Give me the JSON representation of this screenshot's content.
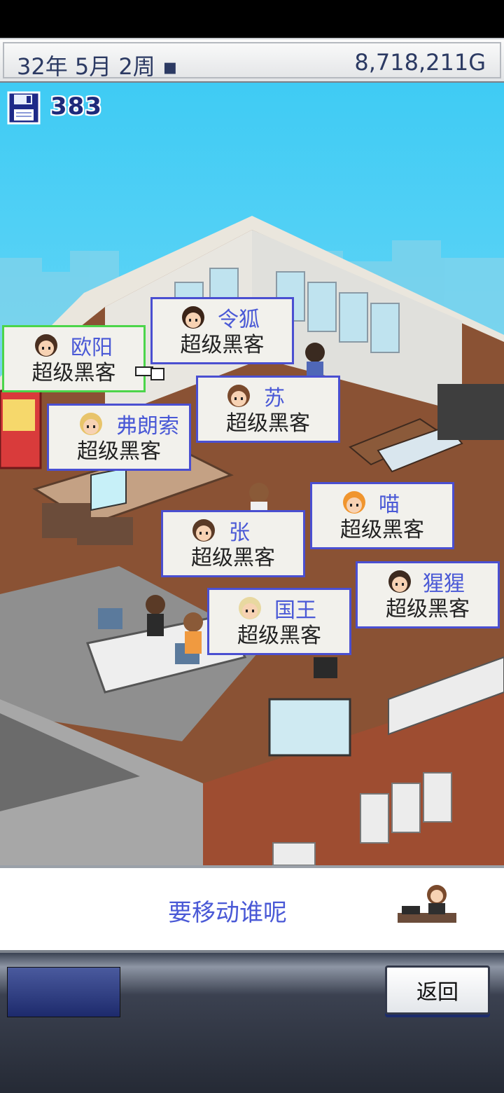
{
  "header": {
    "date": "32年 5月 2周 ▪",
    "money": "8,718,211G"
  },
  "save": {
    "icon": "floppy-disk-icon",
    "count": "383"
  },
  "staff_tags": [
    {
      "name": "欧阳",
      "job": "超级黑客",
      "selected": true
    },
    {
      "name": "令狐",
      "job": "超级黑客",
      "selected": false
    },
    {
      "name": "苏",
      "job": "超级黑客",
      "selected": false
    },
    {
      "name": "弗朗索",
      "job": "超级黑客",
      "selected": false
    },
    {
      "name": "喵",
      "job": "超级黑客",
      "selected": false
    },
    {
      "name": "张",
      "job": "超级黑客",
      "selected": false
    },
    {
      "name": "猩猩",
      "job": "超级黑客",
      "selected": false
    },
    {
      "name": "国王",
      "job": "超级黑客",
      "selected": false
    }
  ],
  "message": {
    "text": "要移动谁呢"
  },
  "buttons": {
    "back_label": "返回"
  },
  "colors": {
    "sky": "#58d5f6",
    "tag_border": "#4a4fd1",
    "tag_selected_border": "#4cd54a",
    "name_text": "#4a59d6",
    "floor": "#8a5234",
    "wall": "#a14f33"
  }
}
